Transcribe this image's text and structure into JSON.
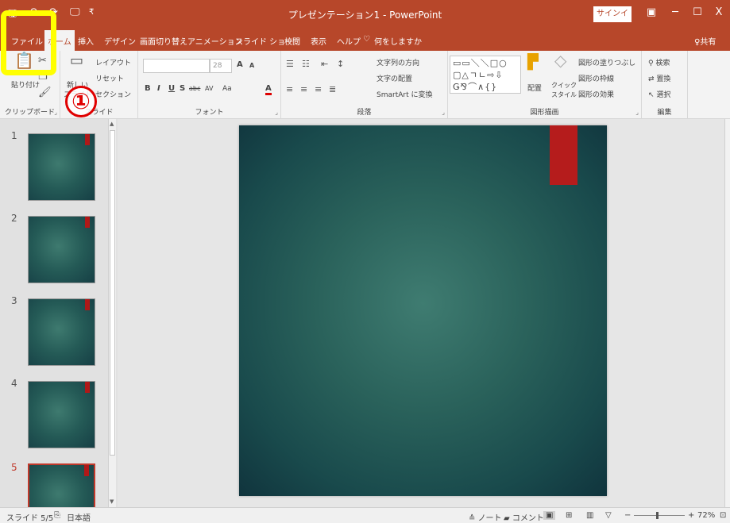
{
  "window": {
    "title": "プレゼンテーション1 - PowerPoint",
    "signin": "サインイン",
    "qa_save": "🖫",
    "qa_undo": "↶",
    "qa_redo": "↷",
    "qa_present": "🖵",
    "qa_more": "₹",
    "ribbon_display": "▣",
    "minimize": "─",
    "maximize": "☐",
    "close": "X"
  },
  "tabs": [
    {
      "label": "ファイル"
    },
    {
      "label": "ホーム"
    },
    {
      "label": "挿入"
    },
    {
      "label": "デザイン"
    },
    {
      "label": "画面切り替え"
    },
    {
      "label": "アニメーション"
    },
    {
      "label": "スライド ショー"
    },
    {
      "label": "校閲"
    },
    {
      "label": "表示"
    },
    {
      "label": "ヘルプ"
    },
    {
      "label": "何をしますか"
    }
  ],
  "share": "共有",
  "ribbon": {
    "clipboard": {
      "paste": "貼り付け",
      "label": "クリップボード"
    },
    "slides": {
      "new_slide_1": "新しい",
      "new_slide_2": "スライド",
      "layout": "レイアウト",
      "reset": "リセット",
      "section": "セクション",
      "label": "スライド"
    },
    "font": {
      "size": "28",
      "grow": "A",
      "shrink": "A",
      "bold": "B",
      "italic": "I",
      "underline": "U",
      "shadow": "S",
      "strike": "abc",
      "spacing": "AV",
      "case": "Aa",
      "color": "A",
      "label": "フォント"
    },
    "paragraph": {
      "text_direction": "文字列の方向",
      "align_text": "文字の配置",
      "smartart": "SmartArt に変換",
      "label": "段落"
    },
    "drawing": {
      "shapes": "▭▭＼＼□○\n▢△ㄱㄴ⇨⇩\nǤ⅋⌒∧{}",
      "arrange": "配置",
      "quick_styles_1": "クイック",
      "quick_styles_2": "スタイル",
      "fill": "図形の塗りつぶし",
      "outline": "図形の枠線",
      "effects": "図形の効果",
      "label": "図形描画"
    },
    "editing": {
      "find": "検索",
      "replace": "置換",
      "select": "選択",
      "label": "編集"
    }
  },
  "thumbnails": [
    {
      "num": "1"
    },
    {
      "num": "2"
    },
    {
      "num": "3"
    },
    {
      "num": "4"
    },
    {
      "num": "5"
    }
  ],
  "annotation": {
    "marker": "①",
    "highlight_color": "#ffff00",
    "marker_color": "#e00000"
  },
  "status": {
    "slide": "スライド 5/5",
    "language": "日本語",
    "notes": "ノート",
    "comments": "コメント",
    "zoom": "72%",
    "zoom_minus": "−",
    "zoom_plus": "+"
  },
  "colors": {
    "accent": "#b7472a",
    "slide_tag": "#b51c1c",
    "slide_bg": "#2a625b"
  }
}
